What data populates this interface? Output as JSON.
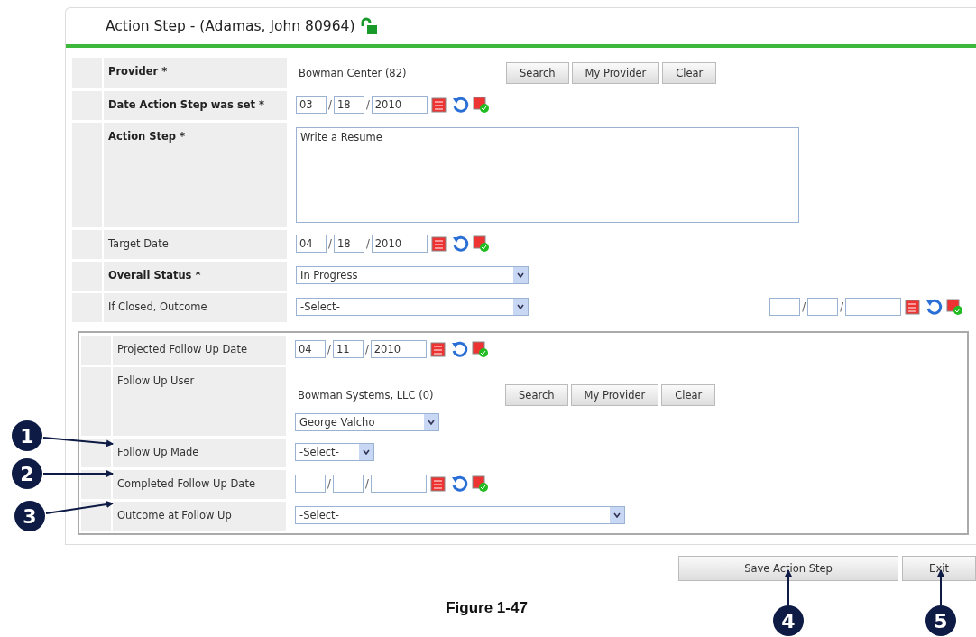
{
  "title": "Action Step - (Adamas, John 80964)",
  "fields": [
    {
      "kind": "lookup",
      "label": "Provider *",
      "required": true,
      "value": "Bowman Center (82)",
      "buttons": [
        "Search",
        "My Provider",
        "Clear"
      ]
    },
    {
      "kind": "date",
      "label": "Date Action Step was set *",
      "required": true,
      "month": "03",
      "day": "18",
      "year": "2010",
      "separators": [
        "/",
        "/"
      ]
    },
    {
      "kind": "textarea",
      "label": "Action Step *",
      "required": true,
      "value": "Write a Resume"
    },
    {
      "kind": "date",
      "label": "Target Date",
      "required": false,
      "month": "04",
      "day": "18",
      "year": "2010",
      "separators": [
        "/",
        "/"
      ]
    },
    {
      "kind": "select",
      "label": "Overall Status *",
      "required": true,
      "value": "In Progress"
    },
    {
      "kind": "select_date",
      "label": "If Closed, Outcome",
      "required": false,
      "value": "-Select-",
      "separators": [
        "/",
        "/"
      ]
    }
  ],
  "follow_up": [
    {
      "kind": "date",
      "label": "Projected Follow Up Date",
      "month": "04",
      "day": "11",
      "year": "2010",
      "separators": [
        "/",
        "/"
      ]
    },
    {
      "kind": "user",
      "label": "Follow Up User",
      "value": "Bowman Systems, LLC (0)",
      "buttons": [
        "Search",
        "My Provider",
        "Clear"
      ],
      "user": "George Valcho"
    },
    {
      "kind": "select_short",
      "label": "Follow Up Made",
      "value": "-Select-"
    },
    {
      "kind": "date",
      "label": "Completed Follow Up Date",
      "separators": [
        "/",
        "/"
      ]
    },
    {
      "kind": "select_long",
      "label": "Outcome at Follow Up",
      "value": "-Select-"
    }
  ],
  "buttons": [
    "Save Action Step",
    "Exit"
  ],
  "caption": "Figure 1-47",
  "callouts": [
    {
      "number": "1"
    },
    {
      "number": "2"
    },
    {
      "number": "3"
    },
    {
      "number": "4"
    },
    {
      "number": "5"
    }
  ]
}
